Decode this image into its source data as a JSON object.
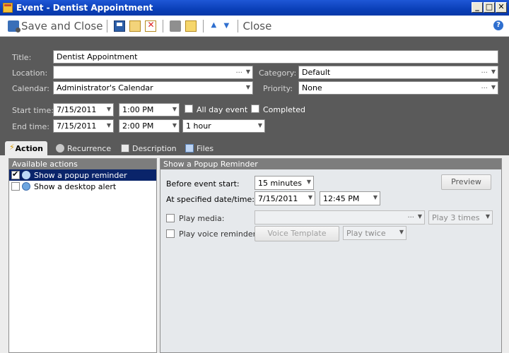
{
  "window": {
    "title": "Event - Dentist Appointment",
    "min": "_",
    "max": "□",
    "close": "✕"
  },
  "toolbar": {
    "save_close": "Save and Close",
    "close": "Close"
  },
  "form": {
    "title_label": "Title:",
    "title_value": "Dentist Appointment",
    "location_label": "Location:",
    "location_value": "",
    "location_dots": "...",
    "category_label": "Category:",
    "category_value": "Default",
    "category_dots": "...",
    "calendar_label": "Calendar:",
    "calendar_value": "Administrator's Calendar",
    "priority_label": "Priority:",
    "priority_value": "None",
    "priority_dots": "...",
    "start_label": "Start time:",
    "start_date": "7/15/2011",
    "start_time": "1:00 PM",
    "all_day_label": "All day event",
    "completed_label": "Completed",
    "end_label": "End time:",
    "end_date": "7/15/2011",
    "end_time": "2:00 PM",
    "duration": "1 hour"
  },
  "tabs": {
    "action": "Action",
    "recurrence": "Recurrence",
    "description": "Description",
    "files": "Files"
  },
  "actions": {
    "header": "Available actions",
    "items": [
      {
        "label": "Show a popup reminder",
        "checked": true
      },
      {
        "label": "Show a desktop alert",
        "checked": false
      }
    ]
  },
  "reminder": {
    "header": "Show a Popup Reminder",
    "before_label": "Before event start:",
    "before_value": "15 minutes",
    "preview_label": "Preview",
    "at_label": "At specified date/time:",
    "at_date": "7/15/2011",
    "at_time": "12:45 PM",
    "media_label": "Play media:",
    "media_dots": "...",
    "media_repeat": "Play 3 times",
    "voice_label": "Play voice reminder:",
    "voice_template": "Voice Template",
    "voice_repeat": "Play twice"
  }
}
